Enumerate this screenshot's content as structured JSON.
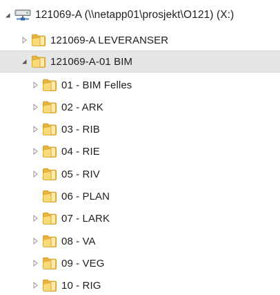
{
  "tree": {
    "root": {
      "label": "121069-A (\\\\netapp01\\prosjekt\\O121) (X:)",
      "icon": "network-drive-icon",
      "expanded": true
    },
    "leveranser": {
      "label": "121069-A LEVERANSER",
      "icon": "folder-icon",
      "expanded": false
    },
    "bim": {
      "label": "121069-A-01 BIM",
      "icon": "folder-icon",
      "expanded": true,
      "selected": true
    },
    "children": [
      {
        "label": "01 - BIM Felles",
        "has_children": true
      },
      {
        "label": "02 - ARK",
        "has_children": true
      },
      {
        "label": "03 - RIB",
        "has_children": true
      },
      {
        "label": "04 - RIE",
        "has_children": true
      },
      {
        "label": "05 - RIV",
        "has_children": true
      },
      {
        "label": "06 - PLAN",
        "has_children": false
      },
      {
        "label": "07 - LARK",
        "has_children": true
      },
      {
        "label": "08 - VA",
        "has_children": true
      },
      {
        "label": "09 - VEG",
        "has_children": true
      },
      {
        "label": "10 - RIG",
        "has_children": true
      }
    ]
  },
  "colors": {
    "selection_bg": "#e6e6e6",
    "folder_body": "#f2c55c",
    "folder_front": "#f7d97c",
    "arrow": "#a6a6a6"
  }
}
